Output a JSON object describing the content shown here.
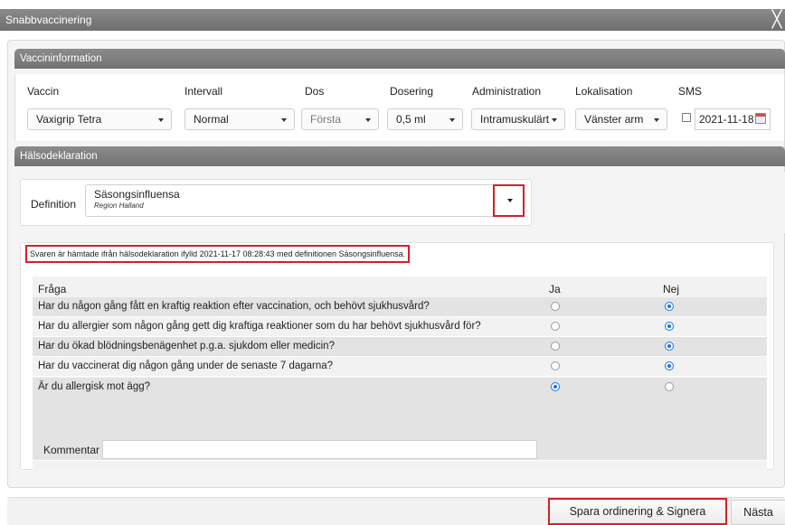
{
  "window": {
    "title": "Snabbvaccinering",
    "close_glyph": "╳"
  },
  "vaccine_info": {
    "section_title": "Vaccininformation",
    "columns": {
      "vaccin": "Vaccin",
      "intervall": "Intervall",
      "dos": "Dos",
      "dosering": "Dosering",
      "administration": "Administration",
      "lokalisation": "Lokalisation",
      "sms": "SMS"
    },
    "values": {
      "vaccin": "Vaxigrip Tetra",
      "intervall": "Normal",
      "dos": "Första",
      "dosering": "0,5 ml",
      "administration": "Intramuskulärt",
      "lokalisation": "Vänster arm",
      "sms_checked": false,
      "sms_date": "2021-11-18"
    }
  },
  "health_declaration": {
    "section_title": "Hälsodeklaration",
    "definition_label": "Definition",
    "definition_value": "Säsongsinfluensa",
    "definition_sub": "Region Halland",
    "notice": "Svaren är hämtade ifrån hälsodeklaration ifylld 2021-11-17 08:28:43 med definitionen Säsongsinfluensa.",
    "table_headers": {
      "question": "Fråga",
      "yes": "Ja",
      "no": "Nej"
    },
    "questions": [
      {
        "text": "Har du någon gång fått en kraftig reaktion efter vaccination, och behövt sjukhusvård?",
        "answer": "Nej"
      },
      {
        "text": "Har du allergier som någon gång gett dig kraftiga reaktioner som du har behövt sjukhusvård för?",
        "answer": "Nej"
      },
      {
        "text": "Har du ökad blödningsbenägenhet p.g.a. sjukdom eller medicin?",
        "answer": "Nej"
      },
      {
        "text": "Har du vaccinerat dig någon gång under de senaste 7 dagarna?",
        "answer": "Nej"
      },
      {
        "text": "Är du allergisk mot ägg?",
        "answer": "Ja"
      }
    ],
    "comment_label": "Kommentar",
    "comment_value": ""
  },
  "footer": {
    "save_sign_label": "Spara ordinering & Signera",
    "next_label": "Nästa"
  },
  "colors": {
    "highlight_border": "#d5202a",
    "radio_selected": "#1a73e8",
    "section_bar": "#7d7d7d"
  },
  "icons": {
    "calendar": "calendar-icon",
    "close": "close-icon",
    "dropdown": "chevron-down-icon"
  }
}
